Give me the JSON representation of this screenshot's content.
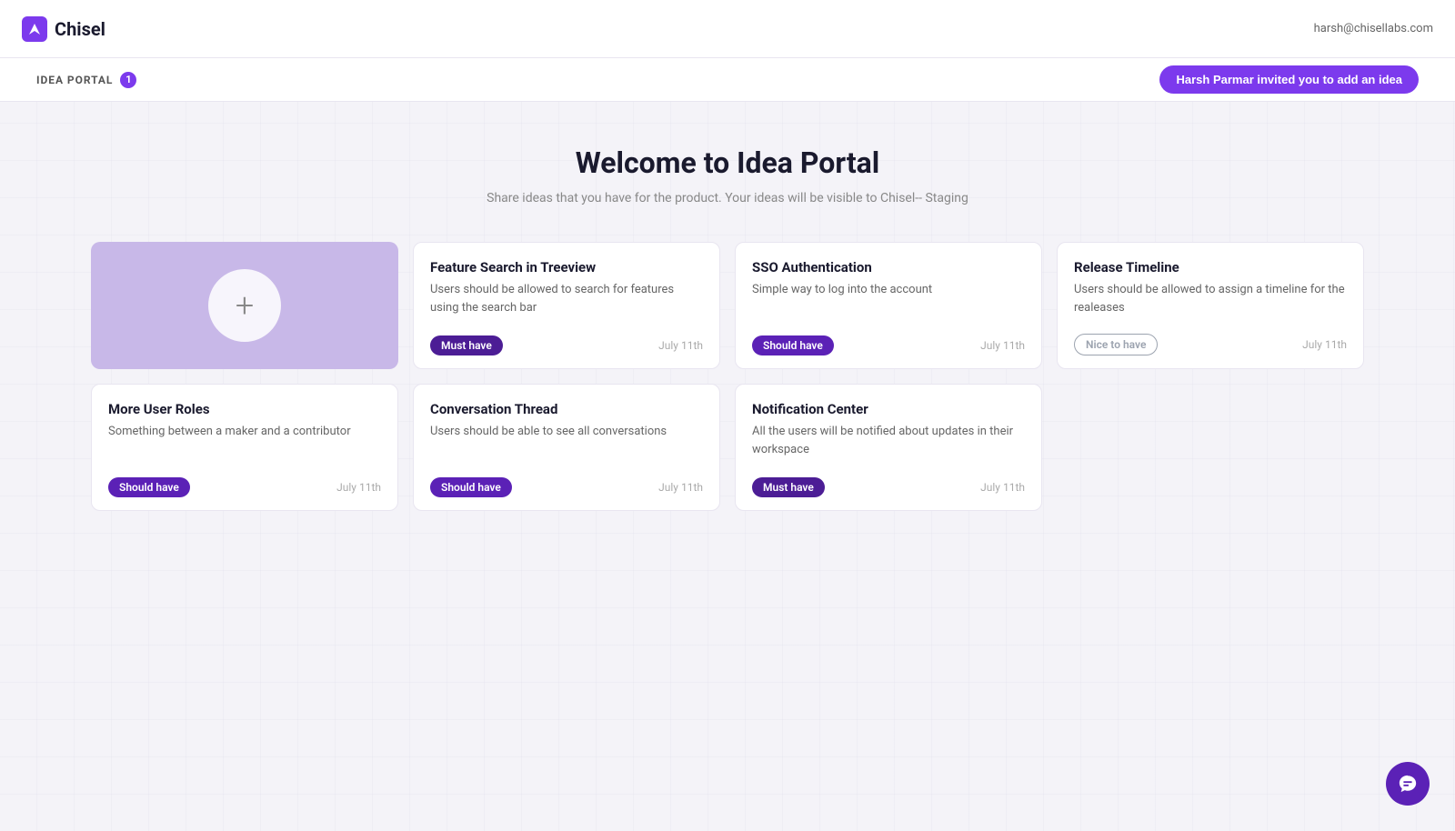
{
  "header": {
    "logo_text": "Chisel",
    "user_email": "harsh@chisellabs.com"
  },
  "sub_header": {
    "portal_label": "IDEA PORTAL",
    "notification_count": "1",
    "invite_button_label": "Harsh Parmar invited you to add an idea"
  },
  "page": {
    "title": "Welcome to Idea Portal",
    "subtitle": "Share ideas that you have for the product. Your ideas will be visible to Chisel-- Staging"
  },
  "add_card": {
    "aria_label": "Add new idea"
  },
  "ideas": [
    {
      "id": 1,
      "title": "Feature Search in Treeview",
      "description": "Users should be allowed to search for features using the search bar",
      "badge": "Must have",
      "badge_type": "must-have",
      "date": "July 11th"
    },
    {
      "id": 2,
      "title": "SSO Authentication",
      "description": "Simple way to log into the account",
      "badge": "Should have",
      "badge_type": "should-have",
      "date": "July 11th"
    },
    {
      "id": 3,
      "title": "Release Timeline",
      "description": "Users should be allowed to assign a timeline for the realeases",
      "badge": "Nice to have",
      "badge_type": "nice-to-have",
      "date": "July 11th"
    },
    {
      "id": 4,
      "title": "More User Roles",
      "description": "Something between a maker and a contributor",
      "badge": "Should have",
      "badge_type": "should-have",
      "date": "July 11th"
    },
    {
      "id": 5,
      "title": "Conversation Thread",
      "description": "Users should be able to see all conversations",
      "badge": "Should have",
      "badge_type": "should-have",
      "date": "July 11th"
    },
    {
      "id": 6,
      "title": "Notification Center",
      "description": "All the users will be notified about updates in their workspace",
      "badge": "Must have",
      "badge_type": "must-have",
      "date": "July 11th"
    }
  ]
}
